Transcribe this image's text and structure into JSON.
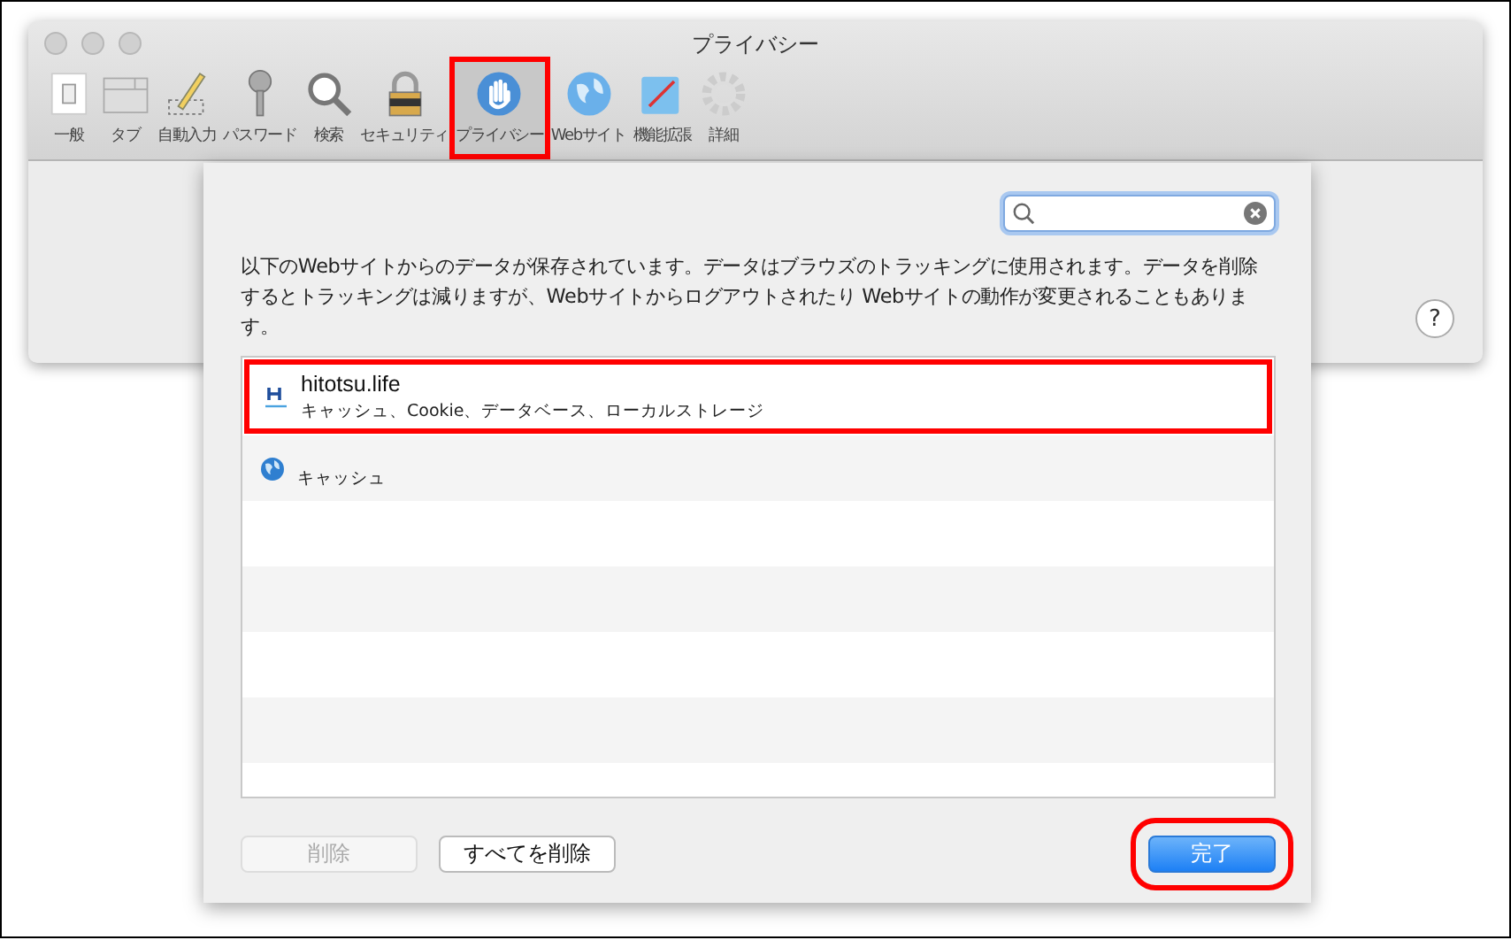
{
  "window": {
    "title": "プライバシー"
  },
  "toolbar": [
    {
      "label": "一般",
      "kind": "general",
      "selected": false
    },
    {
      "label": "タブ",
      "kind": "tabs",
      "selected": false
    },
    {
      "label": "自動入力",
      "kind": "autofill",
      "selected": false
    },
    {
      "label": "パスワード",
      "kind": "passwords",
      "selected": false
    },
    {
      "label": "検索",
      "kind": "search",
      "selected": false
    },
    {
      "label": "セキュリティ",
      "kind": "security",
      "selected": false
    },
    {
      "label": "プライバシー",
      "kind": "privacy",
      "selected": true
    },
    {
      "label": "Webサイト",
      "kind": "websites",
      "selected": false
    },
    {
      "label": "機能拡張",
      "kind": "extensions",
      "selected": false
    },
    {
      "label": "詳細",
      "kind": "advanced",
      "selected": false
    }
  ],
  "help_button": "?",
  "sheet": {
    "description": "以下のWebサイトからのデータが保存されています。データはブラウズのトラッキングに使用されます。データを削除するとトラッキングは減りますが、Webサイトからログアウトされたり Webサイトの動作が変更されることもあります。",
    "sites": [
      {
        "name": "hitotsu.life",
        "detail": "キャッシュ、Cookie、データベース、ローカルストレージ",
        "kind": "letter"
      },
      {
        "detail": "キャッシュ",
        "kind": "globe"
      }
    ],
    "buttons": [
      {
        "label": "削除",
        "kind": "plain",
        "disabled": true
      },
      {
        "label": "すべてを削除",
        "kind": "plain",
        "disabled": false
      },
      {
        "label": "完了",
        "kind": "default",
        "disabled": false
      }
    ]
  }
}
